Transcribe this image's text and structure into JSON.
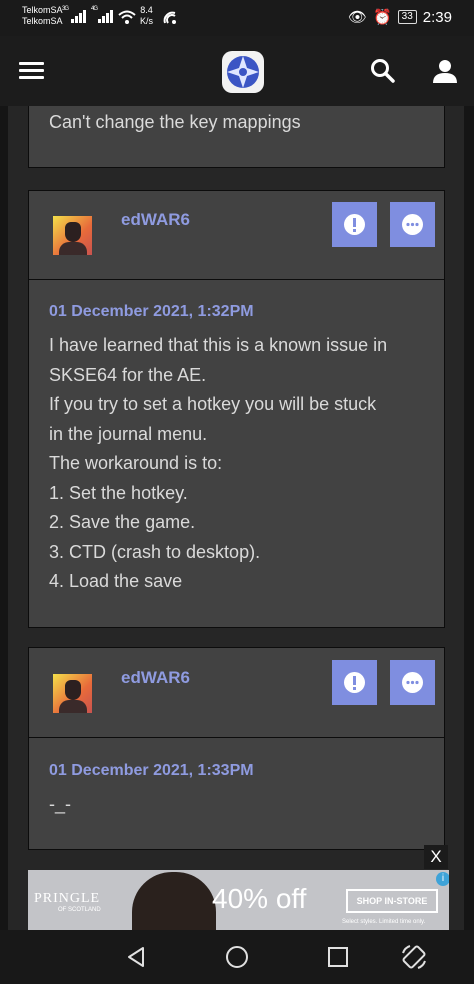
{
  "status_bar": {
    "carrier1": "TelkomSA",
    "carrier2": "TelkomSA",
    "net1": "3G",
    "net2": "4G",
    "speed_value": "8.4",
    "speed_unit": "K/s",
    "battery": "33",
    "time": "2:39"
  },
  "navbar": {
    "menu_icon": "hamburger-icon",
    "logo_icon": "site-logo",
    "search_icon": "search-icon",
    "account_icon": "user-icon"
  },
  "posts": [
    {
      "body": "Can't change the key mappings"
    },
    {
      "username": "edWAR6",
      "date": "01 December 2021, 1:32PM",
      "lines": [
        "I have learned that this is a known issue in",
        "SKSE64 for the AE.",
        "If you try to set a hotkey you will be stuck",
        "in the journal menu.",
        "The workaround is to:",
        "1. Set the hotkey.",
        "2. Save the game.",
        "3. CTD (crash to desktop).",
        "4. Load the save"
      ]
    },
    {
      "username": "edWAR6",
      "date": "01 December 2021, 1:33PM",
      "lines": [
        "-_-"
      ]
    }
  ],
  "ad": {
    "close": "X",
    "brand": "PRINGLE",
    "brand_sub": "OF SCOTLAND",
    "offer": "40% off",
    "cta": "SHOP IN-STORE",
    "small_print": "Select styles. Limited time only.",
    "info_icon": "info-icon",
    "ad_close_icon": "close-icon"
  },
  "colors": {
    "accent": "#7f8ee0",
    "link": "#8f9be0",
    "card": "#424242",
    "background": "#151515"
  }
}
